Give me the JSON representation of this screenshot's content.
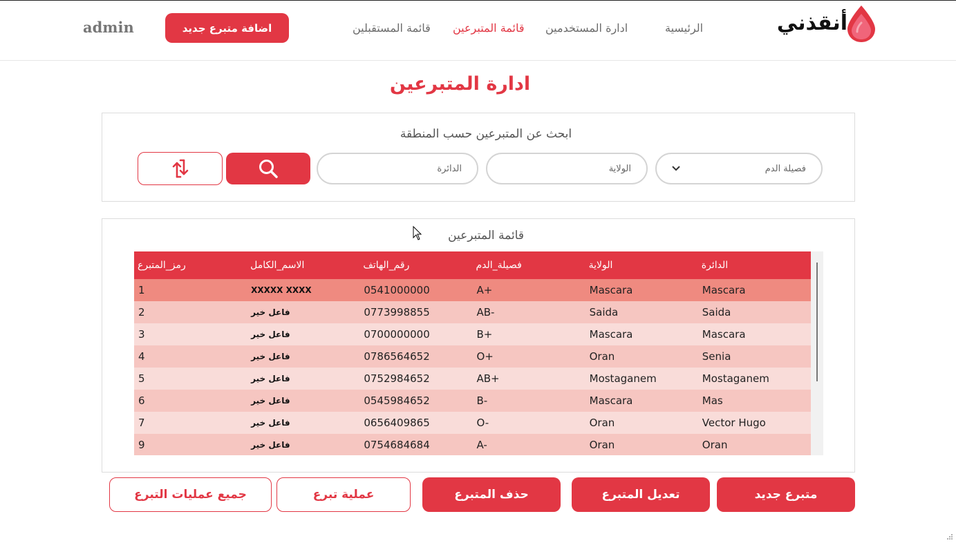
{
  "header": {
    "logo_text": "أنقذني",
    "nav": {
      "home": "الرئيسية",
      "users": "ادارة المستخدمين",
      "donors": "قائمة المتبرعين",
      "recipients": "قائمة المستقبلين"
    },
    "active_nav": "donors",
    "add_donor_button": "اضافة متبرع جديد",
    "user": "admin"
  },
  "page_title": "ادارة المتبرعين",
  "search": {
    "heading": "ابحث عن المتبرعين حسب المنطقة",
    "blood_type_placeholder": "فصيلة الدم",
    "wilaya_placeholder": "الولاية",
    "daira_placeholder": "الدائرة"
  },
  "list": {
    "heading": "قائمة المتبرعين",
    "columns": [
      "رمز_المتبرع",
      "الاسم_الكامل",
      "رقم_الهاتف",
      "فصيلة_الدم",
      "الولاية",
      "الدائرة"
    ],
    "rows": [
      [
        "1",
        "XXXXX XXXX",
        "0541000000",
        "A+",
        "Mascara",
        "Mascara"
      ],
      [
        "2",
        "فاعل خير",
        "0773998855",
        "AB-",
        "Saida",
        "Saida"
      ],
      [
        "3",
        "فاعل خير",
        "0700000000",
        "B+",
        "Mascara",
        "Mascara"
      ],
      [
        "4",
        "فاعل خير",
        "0786564652",
        "O+",
        "Oran",
        "Senia"
      ],
      [
        "5",
        "فاعل خير",
        "0752984652",
        "AB+",
        "Mostaganem",
        "Mostaganem"
      ],
      [
        "6",
        "فاعل خير",
        "0545984652",
        "B-",
        "Mascara",
        "Mas"
      ],
      [
        "7",
        "فاعل خير",
        "0656409865",
        "O-",
        "Oran",
        "Vector Hugo"
      ],
      [
        "9",
        "فاعل خير",
        "0754684684",
        "A-",
        "Oran",
        "Oran"
      ]
    ]
  },
  "actions": {
    "new_donor": "متبرع جديد",
    "edit_donor": "تعديل المتبرع",
    "delete_donor": "حذف المتبرع",
    "donation_operation": "عملية تبرع",
    "all_donations": "جميع عمليات التبرع"
  },
  "colors": {
    "accent": "#e23744",
    "row_selected": "#ef8a80",
    "row_odd": "#f6c6c1",
    "row_even": "#f9dcd9"
  },
  "icons": [
    "blood-drop-icon",
    "search-icon",
    "refresh-icon",
    "chevron-down-icon",
    "mouse-cursor-icon",
    "resize-grip-icon"
  ]
}
